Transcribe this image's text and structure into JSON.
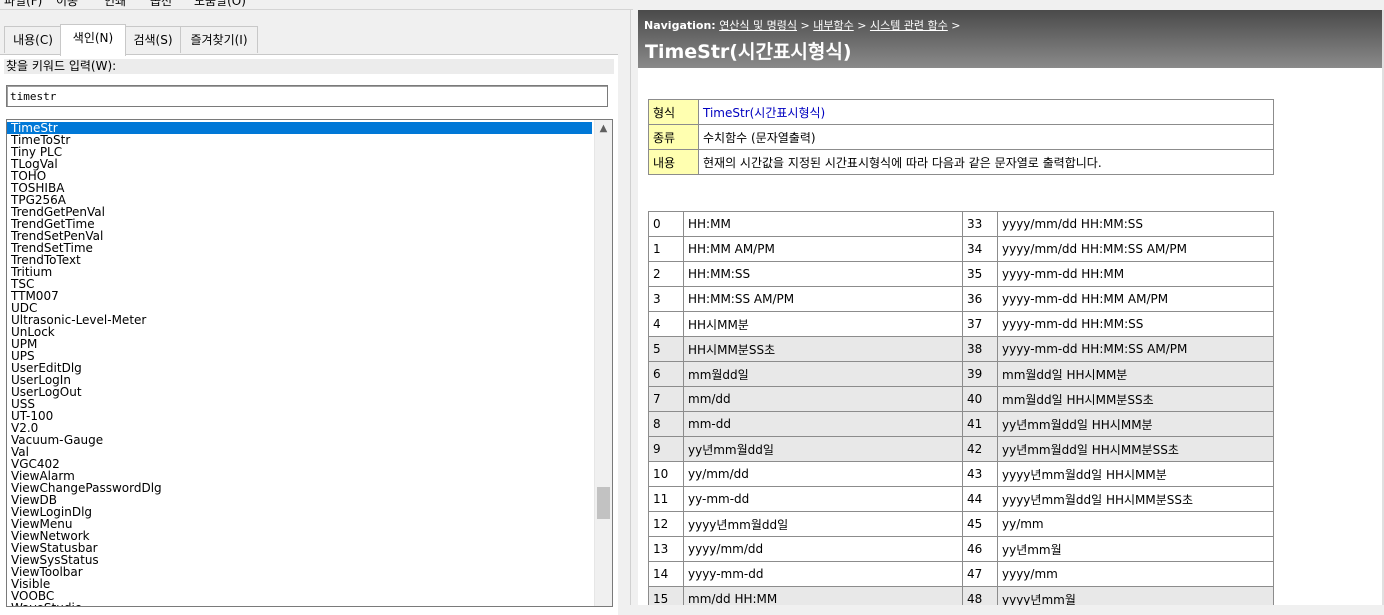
{
  "menubar": {
    "items": [
      "파일(F)",
      "이동",
      "인쇄",
      "옵션",
      "도움말(O)"
    ]
  },
  "tabs": [
    {
      "label": "내용(C)"
    },
    {
      "label": "색인(N)"
    },
    {
      "label": "검색(S)"
    },
    {
      "label": "즐겨찾기(I)"
    }
  ],
  "index": {
    "keyword_label": "찾을 키워드 입력(W):",
    "keyword_value": "timestr",
    "selected": "TimeStr",
    "items": [
      "TimeStr",
      "TimeToStr",
      "Tiny PLC",
      "TLogVal",
      "TOHO",
      "TOSHIBA",
      "TPG256A",
      "TrendGetPenVal",
      "TrendGetTime",
      "TrendSetPenVal",
      "TrendSetTime",
      "TrendToText",
      "Tritium",
      "TSC",
      "TTM007",
      "UDC",
      "Ultrasonic-Level-Meter",
      "UnLock",
      "UPM",
      "UPS",
      "UserEditDlg",
      "UserLogIn",
      "UserLogOut",
      "USS",
      "UT-100",
      "V2.0",
      "Vacuum-Gauge",
      "Val",
      "VGC402",
      "ViewAlarm",
      "ViewChangePasswordDlg",
      "ViewDB",
      "ViewLoginDlg",
      "ViewMenu",
      "ViewNetwork",
      "ViewStatusbar",
      "ViewSysStatus",
      "ViewToolbar",
      "Visible",
      "VOOBC",
      "WaveStudio"
    ]
  },
  "topic": {
    "nav_label": "Navigation:",
    "breadcrumb": [
      "연산식 및 명령식",
      "내부함수",
      "시스템 관련 함수"
    ],
    "separator": ">",
    "title": "TimeStr(시간표시형식)",
    "info": [
      {
        "key": "형식",
        "value": "TimeStr(시간표시형식)"
      },
      {
        "key": "종류",
        "value": "수치함수 (문자열출력)"
      },
      {
        "key": "내용",
        "value": "현재의 시간값을 지정된 시간표시형식에 따라 다음과 같은 문자열로 출력합니다."
      }
    ],
    "formats": [
      {
        "n1": "0",
        "f1": "HH:MM",
        "n2": "33",
        "f2": "yyyy/mm/dd HH:MM:SS",
        "shaded": false
      },
      {
        "n1": "1",
        "f1": "HH:MM AM/PM",
        "n2": "34",
        "f2": "yyyy/mm/dd HH:MM:SS AM/PM",
        "shaded": false
      },
      {
        "n1": "2",
        "f1": "HH:MM:SS",
        "n2": "35",
        "f2": "yyyy-mm-dd HH:MM",
        "shaded": false
      },
      {
        "n1": "3",
        "f1": "HH:MM:SS AM/PM",
        "n2": "36",
        "f2": "yyyy-mm-dd HH:MM AM/PM",
        "shaded": false
      },
      {
        "n1": "4",
        "f1": "HH시MM분",
        "n2": "37",
        "f2": "yyyy-mm-dd HH:MM:SS",
        "shaded": false
      },
      {
        "n1": "5",
        "f1": "HH시MM분SS초",
        "n2": "38",
        "f2": "yyyy-mm-dd HH:MM:SS AM/PM",
        "shaded": true
      },
      {
        "n1": "6",
        "f1": "mm월dd일",
        "n2": "39",
        "f2": "mm월dd일 HH시MM분",
        "shaded": true
      },
      {
        "n1": "7",
        "f1": "mm/dd",
        "n2": "40",
        "f2": "mm월dd일 HH시MM분SS초",
        "shaded": true
      },
      {
        "n1": "8",
        "f1": "mm-dd",
        "n2": "41",
        "f2": "yy년mm월dd일 HH시MM분",
        "shaded": true
      },
      {
        "n1": "9",
        "f1": "yy년mm월dd일",
        "n2": "42",
        "f2": "yy년mm월dd일 HH시MM분SS초",
        "shaded": true
      },
      {
        "n1": "10",
        "f1": "yy/mm/dd",
        "n2": "43",
        "f2": "yyyy년mm월dd일 HH시MM분",
        "shaded": false
      },
      {
        "n1": "11",
        "f1": "yy-mm-dd",
        "n2": "44",
        "f2": "yyyy년mm월dd일 HH시MM분SS초",
        "shaded": false
      },
      {
        "n1": "12",
        "f1": "yyyy년mm월dd일",
        "n2": "45",
        "f2": "yy/mm",
        "shaded": false
      },
      {
        "n1": "13",
        "f1": "yyyy/mm/dd",
        "n2": "46",
        "f2": "yy년mm월",
        "shaded": false
      },
      {
        "n1": "14",
        "f1": "yyyy-mm-dd",
        "n2": "47",
        "f2": "yyyy/mm",
        "shaded": false
      },
      {
        "n1": "15",
        "f1": "mm/dd HH:MM",
        "n2": "48",
        "f2": "yyyy년mm월",
        "shaded": true
      }
    ]
  },
  "colors": {
    "selection": "#0078d7",
    "info_key_bg": "#ffffb0",
    "link_blue": "#0000c0",
    "shaded_row": "#e8e8e8"
  }
}
